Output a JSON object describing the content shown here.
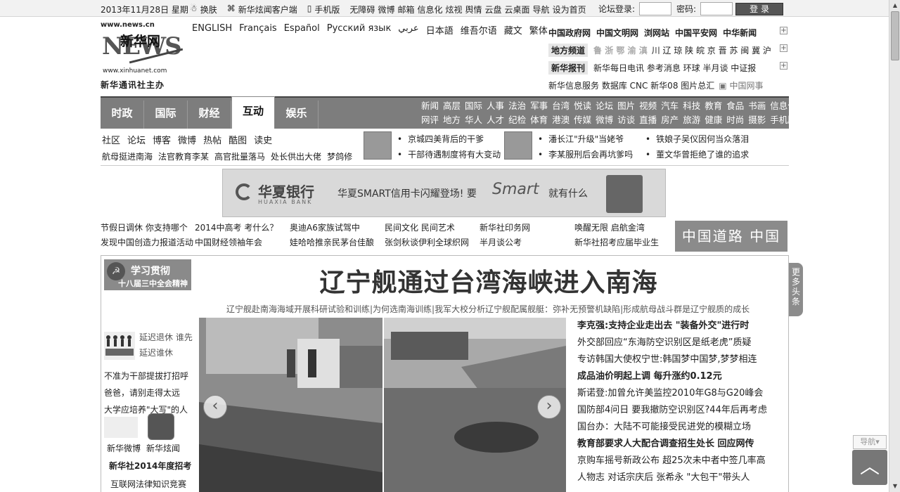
{
  "topbar": {
    "date": "2013年11月28日 星期",
    "links": [
      "换肤",
      "新华炫闻客户端",
      "手机版",
      "无障碍",
      "微博",
      "邮箱",
      "信息化",
      "炫视",
      "舆情",
      "云盘",
      "云桌面",
      "导航",
      "设为首页"
    ],
    "login_label": "论坛登录:",
    "password_label": "密码:",
    "login_button": "登 录"
  },
  "logo": {
    "url": "www.news.cn",
    "news": "NEWS",
    "cn_name": "新华网",
    "site": "www.xinhuanet.com",
    "org": "新华通讯社主办"
  },
  "languages": [
    "ENGLISH",
    "Français",
    "Español",
    "Русский язык",
    "عربي",
    "日本語",
    "维吾尔语",
    "藏文",
    "繁体"
  ],
  "portal": {
    "row1": [
      "中国政府网",
      "中国文明网",
      "浏网站",
      "中国平安网",
      "中华新闻"
    ],
    "row2_tag": "地方频道",
    "row2_grey": "鲁 浙 鄂 渝 滇",
    "row2": "川 辽 琼 陕 皖 京 晋 苏 闽 冀 沪",
    "row3_tag": "新华报刊",
    "row3": "新华每日电讯 参考消息 环球 半月谈 中证报",
    "row4": "新华信息服务  数据库  CNC  新华08  图片总汇",
    "row4_extra": "中国网事"
  },
  "nav": {
    "tabs": [
      "时政",
      "国际",
      "财经",
      "互动",
      "娱乐"
    ],
    "active_tab": "互动",
    "sub_row1": [
      "新闻",
      "高层",
      "国际",
      "人事",
      "法治",
      "军事",
      "台湾",
      "悦读",
      "论坛",
      "图片",
      "视频",
      "汽车",
      "科技",
      "教育",
      "食品",
      "书画",
      "信息化",
      "资料",
      "能源",
      "家居",
      "出国"
    ],
    "sub_row2": [
      "网评",
      "地方",
      "华人",
      "人才",
      "纪检",
      "体育",
      "港澳",
      "传媒",
      "微博",
      "访谈",
      "直播",
      "房产",
      "旅游",
      "健康",
      "时尚",
      "摄影",
      "手机版",
      "公益",
      "舆情",
      "收藏",
      "城市"
    ]
  },
  "community": {
    "links": [
      "社区",
      "论坛",
      "博客",
      "微博",
      "热帖",
      "酷图",
      "读史"
    ],
    "hot": [
      "航母挺进南海",
      "法官教育李某",
      "高官批量落马",
      "处长供出大佬",
      "梦鸽修"
    ],
    "news_a": [
      "京城四美背后的干爹",
      "干部待遇制度将有大变动"
    ],
    "news_b": [
      "潘长江\"升级\"当姥爷",
      "李某服刑后会再坑爹吗"
    ],
    "news_c": [
      "铁娘子吴仪因何当众落泪",
      "董文华曾拒绝了谁的追求"
    ]
  },
  "banner": {
    "bank": "华夏银行",
    "bank_en": "HUAXIA BANK",
    "slogan": "华夏SMART信用卡闪耀登场!  要",
    "smart": "Smart",
    "tail": "就有什么"
  },
  "link_grid": [
    "节假日调休 你支持哪个",
    "2014中高考 考什么？",
    "奥迪A6家族试驾中",
    "民间文化 民间艺术",
    "新华社印务网",
    "唤醒无限 启航金湾",
    "发现中国创造力报道活动",
    "中国财经领袖年会",
    "娃哈哈推亲民茅台佳酿",
    "张剑秋谈伊利全球织网",
    "半月谈公考",
    "新华社招考应届毕业生"
  ],
  "china_dream": "中国道路 中国梦",
  "study": {
    "title": "学习贯彻",
    "sub": "十八届三中全会精神"
  },
  "left_col": {
    "retire": [
      "延迟退休 谁先",
      "延迟谁休"
    ],
    "items": [
      "不准为干部提拔打招呼",
      "爸爸，请别走得太远",
      "大学应培养\"大写\"的人"
    ],
    "weibo": "新华微博",
    "xuanwen": "新华炫闻",
    "recruit": "新华社2014年度招考",
    "law": "互联网法律知识竞赛"
  },
  "headline": {
    "title": "辽宁舰通过台湾海峡进入南海",
    "sub": "辽宁舰赴南海海域开展科研试验和训练|为何选南海训练|我军大校分析辽宁舰配属舰艇：弥补无预警机缺陷|形成航母战斗群是辽宁舰质的成长"
  },
  "right_news": [
    {
      "text": "李克强:支持企业走出去 \"装备外交\"进行时",
      "bold": true
    },
    {
      "text": "外交部回应“东海防空识别区是纸老虎”质疑",
      "bold": false
    },
    {
      "text": "专访韩国大使权宁世:韩国梦中国梦,梦梦相连",
      "bold": false
    },
    {
      "text": "成品油价明起上调 每升涨约0.12元",
      "bold": true
    },
    {
      "text": "斯诺登:加曾允许美监控2010年G8与G20峰会",
      "bold": false
    },
    {
      "text": "国防部4问日 要我撤防空识别区?44年后再考虑",
      "bold": false
    },
    {
      "text": "国台办：大陆不可能接受民进党的模糊立场",
      "bold": false
    },
    {
      "text": "教育部要求人大配合调查招生处长 回应网传",
      "bold": true
    },
    {
      "text": "京购车摇号新政公布 超25次未中者中签几率高",
      "bold": false
    },
    {
      "text": "人物志 对话宗庆后 张希永 \"大包干\"带头人",
      "bold": false
    }
  ],
  "more": "更多头条",
  "nav_button": "导航",
  "colors": {
    "nav": "#7d7d7d",
    "accent": "#555555"
  }
}
